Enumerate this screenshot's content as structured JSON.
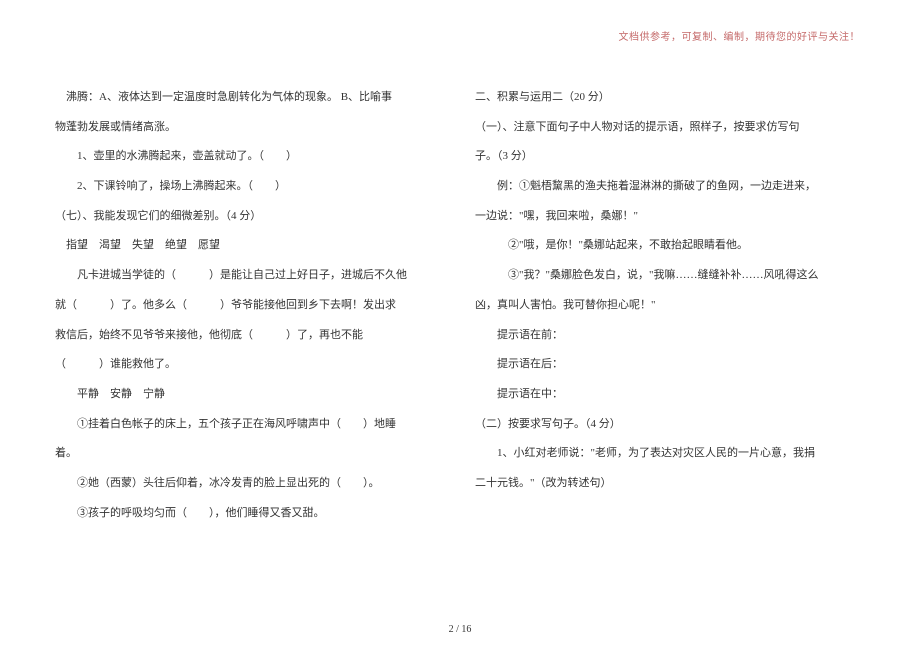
{
  "header": {
    "note": "文档供参考，可复制、编制，期待您的好评与关注！"
  },
  "leftColumn": {
    "l1": "沸腾：A、液体达到一定温度时急剧转化为气体的现象。 B、比喻事",
    "l2": "物蓬勃发展或情绪高涨。",
    "l3": "1、壶里的水沸腾起来，壶盖就动了。（　　）",
    "l4": "2、下课铃响了，操场上沸腾起来。（　　）",
    "l5": "（七）、我能发现它们的细微差别。（4 分）",
    "l6": "指望　渴望　失望　绝望　愿望",
    "l7": "凡卡进城当学徒的（　　　）是能让自己过上好日子，进城后不久他",
    "l8": "就（　　　）了。他多么（　　　）爷爷能接他回到乡下去啊！发出求",
    "l9": "救信后，始终不见爷爷来接他，他彻底（　　　）了，再也不能",
    "l10": "（　　　）谁能救他了。",
    "l11": "平静　安静　宁静",
    "l12": "①挂着白色帐子的床上，五个孩子正在海风呼啸声中（　　）地睡",
    "l13": "着。",
    "l14": "②她（西蒙）头往后仰着，冰冷发青的脸上显出死的（　　）。",
    "l15": "③孩子的呼吸均匀而（　　），他们睡得又香又甜。"
  },
  "rightColumn": {
    "r1": "二、积累与运用二（20 分）",
    "r2": "（一）、注意下面句子中人物对话的提示语，照样子，按要求仿写句",
    "r3": "子。（3 分）",
    "r4": "例：①魁梧黧黑的渔夫拖着湿淋淋的撕破了的鱼网，一边走进来，",
    "r5": "一边说：\"嘿，我回来啦，桑娜！\"",
    "r6": "②\"哦，是你！\"桑娜站起来，不敢抬起眼睛看他。",
    "r7": "③\"我？\"桑娜脸色发白，说，\"我嘛……缝缝补补……风吼得这么",
    "r8": "凶，真叫人害怕。我可替你担心呢！\"",
    "r9": "提示语在前：",
    "r10": "提示语在后：",
    "r11": "提示语在中：",
    "r12": "（二）按要求写句子。（4 分）",
    "r13": "1、小红对老师说：\"老师，为了表达对灾区人民的一片心意，我捐",
    "r14": "二十元钱。\"（改为转述句）"
  },
  "footer": {
    "page": "2 / 16"
  }
}
